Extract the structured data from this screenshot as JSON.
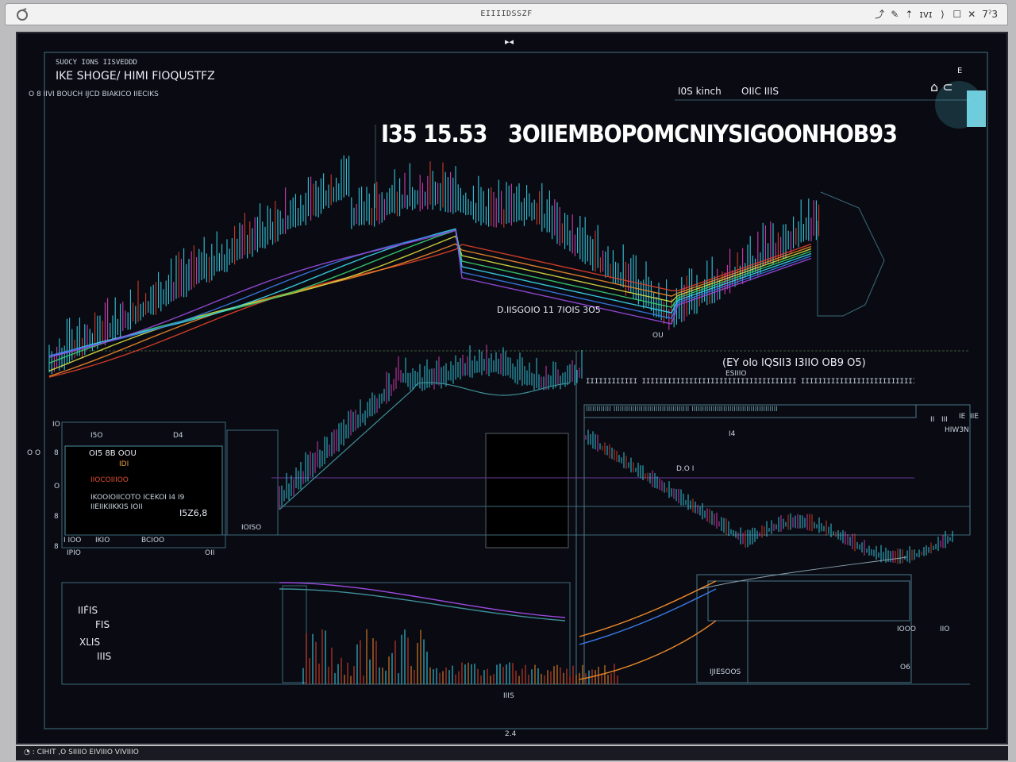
{
  "window": {
    "title": "EIIIIDSSZF",
    "controls": [
      "⤴",
      "✎",
      "⇡",
      "ɪvɪ",
      "⟩",
      "☐",
      "✕",
      "7ˀ3"
    ]
  },
  "top_center_marker": "▸◂",
  "header": {
    "line1": "SUOCY IONS IISVEDDD",
    "line2": "IKE SHOGE/ HIMI FIOQUSTFZ",
    "line3": "O 8  IIVI BOUCH IJCD  BIAKICO IIECIKS",
    "tab_a": "I0S kinch",
    "tab_b": "OIIC IIIS",
    "icon_top": "E",
    "icon_glyph": "⌂ ⊂"
  },
  "headline": {
    "left": "I35 15.53",
    "right": "3OIIEMBOPOMCNIYSIGOONHOB93I8"
  },
  "main_chart": {
    "annotation": "D.IISGOIO 11 7IOIS 3O5",
    "under_label": "OU"
  },
  "mid_row": {
    "text": "(EY olo  IQSII3   I3IIO   OB9 O5)",
    "sub": "ESIIIO",
    "bar_label": "IIIIIIIIIIII IIIIIIIIIIIIIIIIIIIIIIIIIIIIIIIIIIII IIIIIIIIIIIIIIIIIIIIIIIIIIIIIIIIIIIIIIIII",
    "right_labels": [
      "IE",
      "IIE",
      "II",
      "III",
      "HIW3N"
    ]
  },
  "left_panel": {
    "axis_labels": [
      "IO",
      "8",
      "O",
      "8",
      "8"
    ],
    "left_side": "O O",
    "top_label": "I5O",
    "top_right": "D4",
    "row1": "OI5 8B  OOU",
    "row1b": "IDI",
    "row2": "IIOCOIIIOO",
    "row3": "IKOOIOIICOTO ICEKOI   I4 I9",
    "row4": "IIEIIKIIKKIS IOII",
    "row5": "I5Z6,8",
    "bottom": [
      "I IOO",
      "IKIO",
      "BCIOO"
    ],
    "bottom2": [
      "IPIO",
      "OII"
    ]
  },
  "small_box": {
    "label": "IOISO"
  },
  "right_mid": {
    "label_a": "I4",
    "label_b": "D.O I"
  },
  "bottom_panel": {
    "left_labels": [
      "IIF́IS",
      "FIS",
      "XLIS",
      "IIIS"
    ],
    "box_label": "IJIESOOS",
    "right_a": "IOOO",
    "right_b": "IIO",
    "right_c": "O6",
    "bottom_center": "IIIS"
  },
  "bottom_marker": "2.4",
  "footer": "◔ :  CIHIT ,O  SIIIIO EIVIIIO VIVIIIO",
  "chart_data": {
    "type": "line",
    "title": "",
    "series": [
      {
        "name": "",
        "values": []
      }
    ]
  },
  "colors": {
    "background": "#0a0b12",
    "cyan": "#38d8f0",
    "teal": "#3e8f9a",
    "red": "#e0402a",
    "orange": "#f08a2a",
    "yellow": "#d8e040",
    "green": "#38d070",
    "blue": "#3a7ae8",
    "purple": "#9a4ae0",
    "magenta": "#e040c0"
  }
}
